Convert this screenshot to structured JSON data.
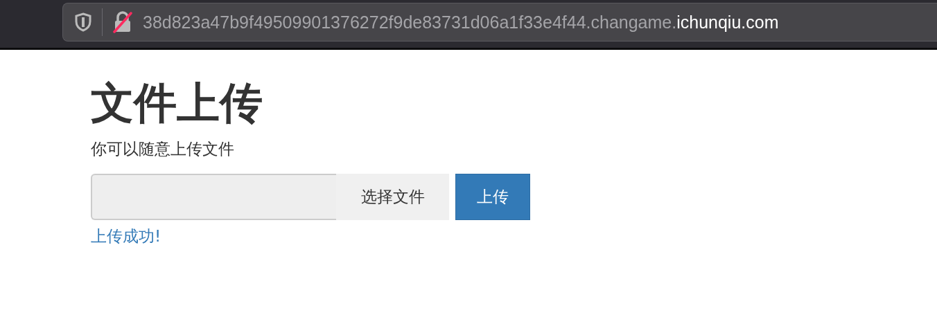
{
  "address_bar": {
    "url_host": "38d823a47b9f49509901376272f9de83731d06a1f33e4f44.changame.",
    "url_domain": "ichunqiu.com",
    "insecure": true
  },
  "heading": "文件上传",
  "description": "你可以随意上传文件",
  "file_input": {
    "button": "选择文件"
  },
  "upload_button": "上传",
  "message": "上传成功!"
}
